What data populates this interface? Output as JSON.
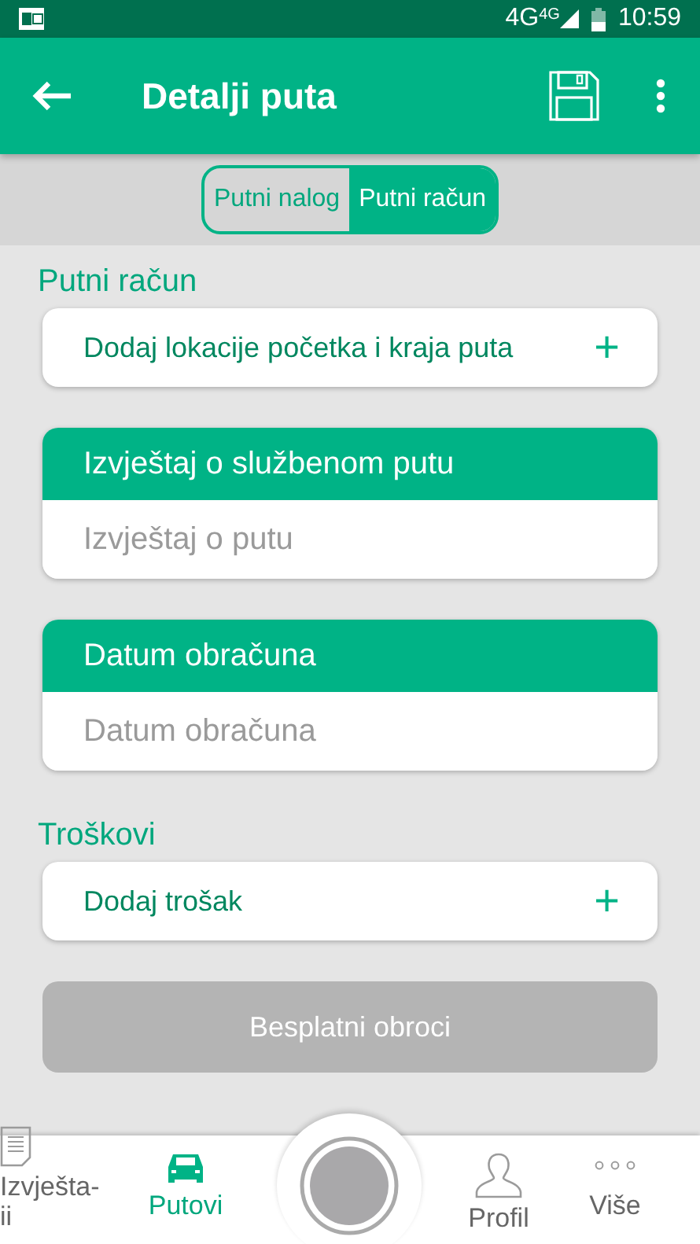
{
  "status_bar": {
    "network": "4G",
    "network_small": "4G",
    "time": "10:59"
  },
  "toolbar": {
    "title": "Detalji puta"
  },
  "segments": [
    {
      "label": "Putni nalog",
      "selected": false
    },
    {
      "label": "Putni račun",
      "selected": true
    }
  ],
  "sections": [
    {
      "kind": "label",
      "text": "Putni račun"
    },
    {
      "kind": "add",
      "text": "Dodaj lokacije početka i kraja puta",
      "icon": "+"
    },
    {
      "kind": "field",
      "header": "Izvještaj o službenom putu",
      "placeholder": "Izvještaj o putu"
    },
    {
      "kind": "field",
      "header": "Datum obračuna",
      "placeholder": "Datum obračuna"
    },
    {
      "kind": "label",
      "text": "Troškovi"
    },
    {
      "kind": "add",
      "text": "Dodaj trošak",
      "icon": "+"
    },
    {
      "kind": "button",
      "text": "Besplatni obroci",
      "disabled": true
    }
  ],
  "bottom_nav": [
    {
      "label": "Izvješta-ii",
      "kind": "report",
      "selected": false
    },
    {
      "label": "Putovi",
      "kind": "car",
      "selected": true
    },
    {
      "kind": "record",
      "selected": false
    },
    {
      "label": "Profil",
      "kind": "person",
      "selected": false
    },
    {
      "label": "Više",
      "kind": "more",
      "selected": false
    }
  ]
}
